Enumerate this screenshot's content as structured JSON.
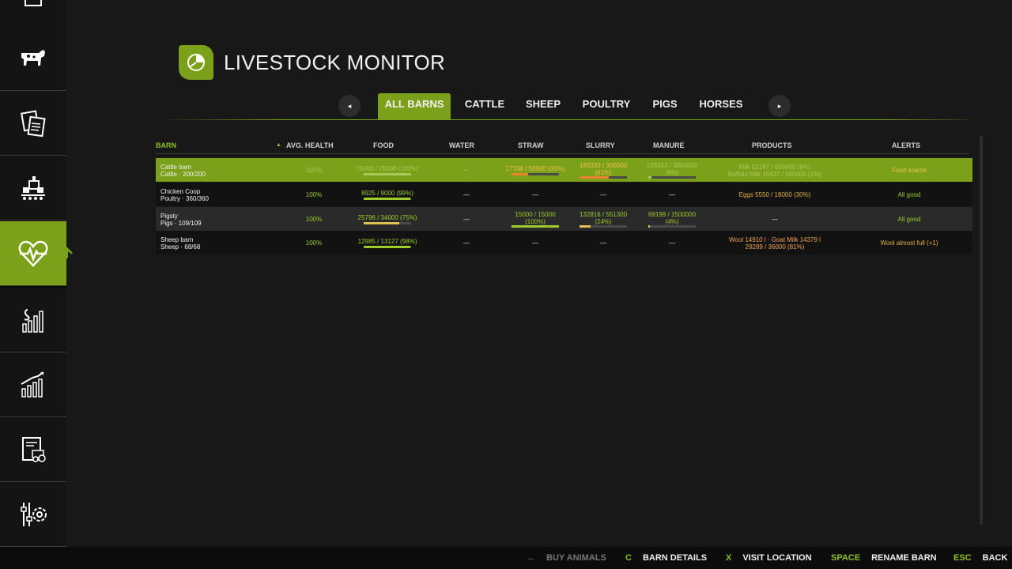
{
  "header": {
    "title": "LIVESTOCK MONITOR"
  },
  "sidebar": {
    "items": [
      {
        "icon": "shop-icon"
      },
      {
        "icon": "cow-icon"
      },
      {
        "icon": "documents-icon"
      },
      {
        "icon": "production-icon"
      },
      {
        "icon": "heart-rate-icon",
        "active": true
      },
      {
        "icon": "prices-chart-icon"
      },
      {
        "icon": "statistics-chart-icon"
      },
      {
        "icon": "contracts-tractor-icon"
      },
      {
        "icon": "settings-icon"
      }
    ]
  },
  "tabs": {
    "prev_glyph": "◂",
    "next_glyph": "▸",
    "items": [
      {
        "label": "ALL BARNS",
        "active": true
      },
      {
        "label": "CATTLE"
      },
      {
        "label": "SHEEP"
      },
      {
        "label": "POULTRY"
      },
      {
        "label": "PIGS"
      },
      {
        "label": "HORSES"
      }
    ]
  },
  "table": {
    "sort_glyph": "▲",
    "columns": [
      "BARN",
      "AVG. HEALTH",
      "FOOD",
      "WATER",
      "STRAW",
      "SLURRY",
      "MANURE",
      "PRODUCTS",
      "ALERTS"
    ],
    "rows": [
      {
        "name": "Cattle barn",
        "sub": "Cattle · 200/200",
        "health": "100%",
        "food": "75000 / 75000  (100%)",
        "food_pct": 1.0,
        "water": "—",
        "straw": "17708 / 50000  (35%)",
        "straw_pct": 0.35,
        "slurry": "183333 / 300000",
        "slurry_sub": "(61%)",
        "slurry_pct": 0.61,
        "manure": "183333 / 3000000",
        "manure_sub": "(6%)",
        "manure_pct": 0.06,
        "products": "Milk 52187 / 600000  (8%)",
        "products_sub": "Buffalo Milk 10437 / 560000  (1%)",
        "alert": "Food scarce"
      },
      {
        "name": "Chicken Coop",
        "sub": "Poultry · 360/360",
        "health": "100%",
        "food": "8925 / 9000  (99%)",
        "food_pct": 0.99,
        "water": "—",
        "straw": "—",
        "slurry": "—",
        "manure": "—",
        "products": "Eggs 5550 / 18000  (30%)",
        "alert": "All good"
      },
      {
        "name": "Pigsty",
        "sub": "Pigs · 109/109",
        "health": "100%",
        "food": "25796 / 34000  (75%)",
        "food_pct": 0.75,
        "water": "—",
        "straw": "15000 / 15000",
        "straw_sub": "(100%)",
        "straw_pct": 1.0,
        "slurry": "132816 / 551300",
        "slurry_sub": "(24%)",
        "slurry_pct": 0.24,
        "manure": "69199 / 1500000",
        "manure_sub": "(4%)",
        "manure_pct": 0.04,
        "products": "—",
        "alert": "All good"
      },
      {
        "name": "Sheep barn",
        "sub": "Sheep · 68/68",
        "health": "100%",
        "food": "12985 / 13127  (98%)",
        "food_pct": 0.98,
        "water": "—",
        "straw": "—",
        "slurry": "—",
        "manure": "—",
        "products": "Wool 14910 l · Goat Milk 14379 l",
        "products_sub": "29289 / 36000  (81%)",
        "alert": "Wool almost full (+1)"
      }
    ]
  },
  "footer": {
    "buttons": [
      {
        "key": "↔",
        "label": "BUY ANIMALS",
        "disabled": true
      },
      {
        "key": "C",
        "label": "BARN DETAILS"
      },
      {
        "key": "X",
        "label": "VISIT LOCATION"
      },
      {
        "key": "SPACE",
        "label": "RENAME BARN"
      },
      {
        "key": "ESC",
        "label": "BACK"
      }
    ]
  },
  "colors": {
    "accent": "#7ba01a",
    "ok": "#9ccc2a",
    "warn": "#f0a050",
    "alert": "#e0b040"
  }
}
